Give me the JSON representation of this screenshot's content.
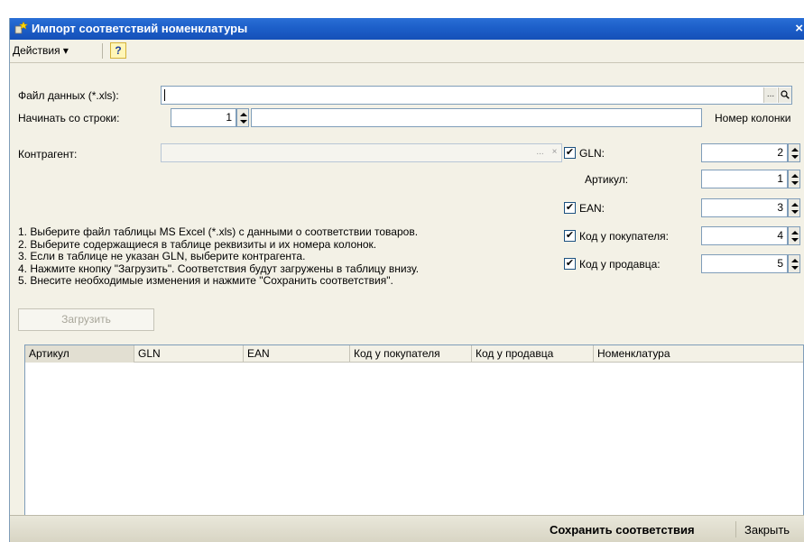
{
  "window": {
    "title": "Импорт соответствий номенклатуры",
    "close_glyph": "×"
  },
  "toolbar": {
    "actions_label": "Действия",
    "actions_arrow": "▾",
    "help_label": "?"
  },
  "form": {
    "file_label": "Файл данных (*.xls):",
    "file_value": "",
    "file_browse": "...",
    "file_open_icon": "magnifier-icon",
    "start_row_label": "Начинать со строки:",
    "start_row_value": "1",
    "column_number_header": "Номер колонки",
    "contractor_label": "Контрагент:",
    "contractor_value": "",
    "contractor_browse": "...",
    "contractor_clear": "×"
  },
  "instructions": [
    "1. Выберите файл таблицы MS Excel (*.xls) с данными о соответствии товаров.",
    "2. Выберите содержащиеся в таблице реквизиты и их номера колонок.",
    "3. Если в таблице не указан GLN, выберите контрагента.",
    "4. Нажмите кнопку \"Загрузить\". Соответствия будут загружены в таблицу внизу.",
    "5. Внесите необходимые изменения и нажмите \"Сохранить соответствия\"."
  ],
  "load_button": "Загрузить",
  "columns_settings": [
    {
      "label": "GLN:",
      "checked": true,
      "value": "2"
    },
    {
      "label": "Артикул:",
      "checked": null,
      "value": "1"
    },
    {
      "label": "EAN:",
      "checked": true,
      "value": "3"
    },
    {
      "label": "Код у покупателя:",
      "checked": true,
      "value": "4"
    },
    {
      "label": "Код у продавца:",
      "checked": true,
      "value": "5"
    }
  ],
  "check_glyph": "✔",
  "grid": {
    "columns": [
      "Артикул",
      "GLN",
      "EAN",
      "Код у покупателя",
      "Код у продавца",
      "Номенклатура"
    ]
  },
  "footer": {
    "save_label": "Сохранить соответствия",
    "close_label": "Закрыть"
  }
}
